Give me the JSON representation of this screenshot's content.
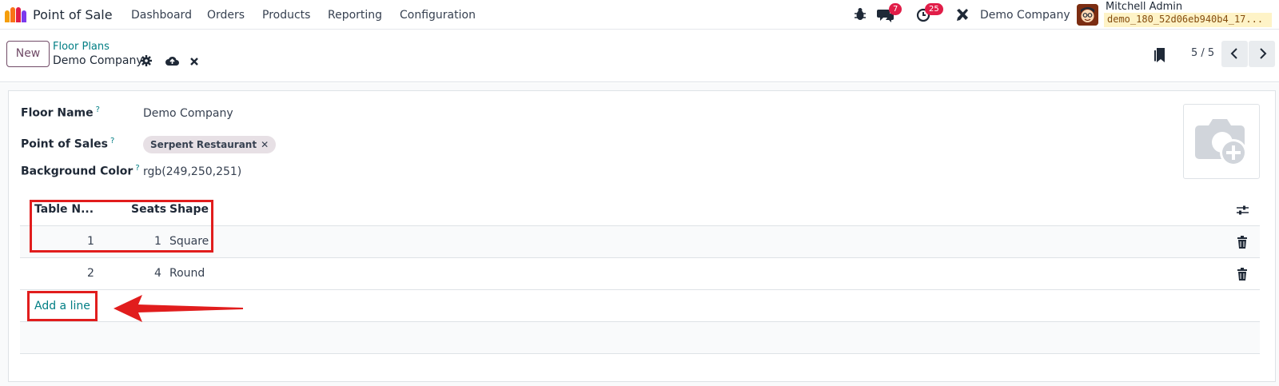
{
  "navbar": {
    "app_title": "Point of Sale",
    "menu": [
      "Dashboard",
      "Orders",
      "Products",
      "Reporting",
      "Configuration"
    ],
    "messages_count": "7",
    "activities_count": "25",
    "company": "Demo Company",
    "user_name": "Mitchell Admin",
    "database": "demo_180_52d06eb940b4_17..."
  },
  "controlbar": {
    "new_label": "New",
    "breadcrumb_parent": "Floor Plans",
    "breadcrumb_current": "Demo Company",
    "pager": "5 / 5"
  },
  "form": {
    "floor_name_label": "Floor Name",
    "floor_name_value": "Demo Company",
    "pos_label": "Point of Sales",
    "pos_tag": "Serpent Restaurant",
    "bg_color_label": "Background Color",
    "bg_color_value": "rgb(249,250,251)",
    "help_mark": "?"
  },
  "table": {
    "headers": [
      "Table N...",
      "Seats",
      "Shape"
    ],
    "rows": [
      {
        "number": "1",
        "seats": "1",
        "shape": "Square"
      },
      {
        "number": "2",
        "seats": "4",
        "shape": "Round"
      }
    ],
    "add_line": "Add a line"
  },
  "colors": {
    "accent": "#714b67",
    "link": "#017e84",
    "annotation": "#e11d1d",
    "badge": "#e11d48"
  },
  "icons": [
    "bug-icon",
    "chat-icon",
    "clock-icon",
    "tools-icon",
    "gear-icon",
    "cloud-upload-icon",
    "close-icon",
    "bookmark-icon",
    "chevron-left-icon",
    "chevron-right-icon",
    "camera-plus-icon",
    "sliders-icon",
    "trash-icon"
  ]
}
